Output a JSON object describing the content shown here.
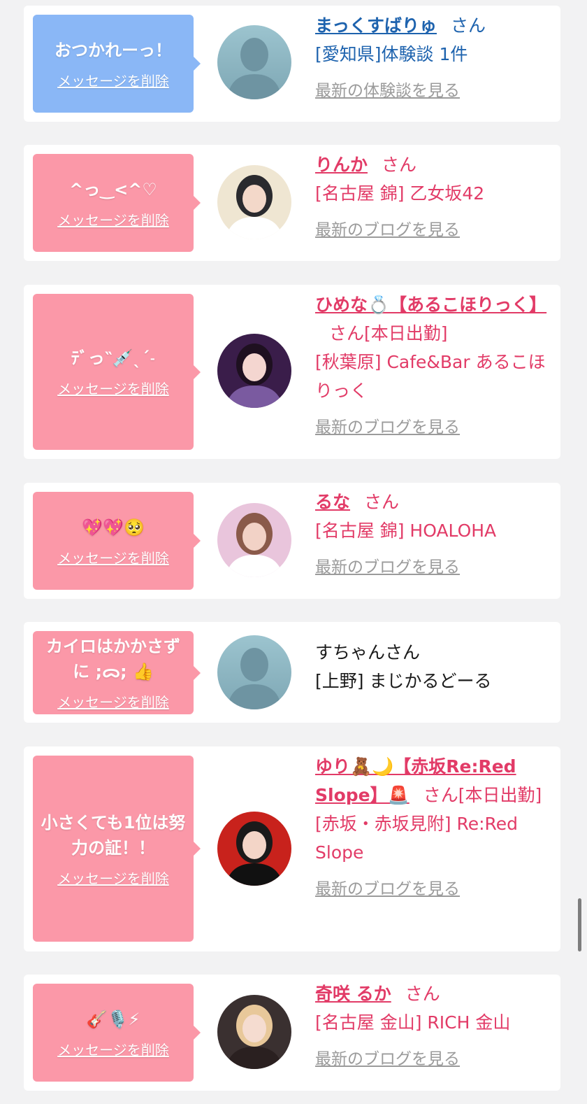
{
  "delete_label": "メッセージを削除",
  "colors": {
    "blue_bubble": "#8ab7f6",
    "pink_bubble": "#fb98a8",
    "blue_text": "#1e63ae",
    "pink_text": "#e23b67"
  },
  "cards": [
    {
      "message": "おつかれーっ！",
      "bubble": "blue",
      "name": "まっくすばりゅ",
      "suffix": "さん",
      "status": "",
      "detail": "[愛知県]体験談 1件",
      "link": "最新の体験談を見る",
      "avatar": "no-photo",
      "avatar_text": "no photo"
    },
    {
      "message": "^っ‿<^♡",
      "bubble": "pink",
      "name": "りんか",
      "suffix": "さん",
      "status": "",
      "detail": "[名古屋 錦] 乙女坂42",
      "link": "最新のブログを見る",
      "avatar": "photo-vip-bg"
    },
    {
      "message": "ﾃﾞっ‶💉ˎˊ˗",
      "bubble": "pink",
      "name": "ひめな💍【あるこほりっく】",
      "suffix": "さん",
      "status": "[本日出勤]",
      "detail": "[秋葉原] Cafe&Bar あるこほりっく",
      "link": "最新のブログを見る",
      "avatar": "photo-purple"
    },
    {
      "message": "💖💖🥺",
      "bubble": "pink",
      "name": "るな",
      "suffix": "さん",
      "status": "",
      "detail": "[名古屋 錦] HOALOHA",
      "link": "最新のブログを見る",
      "avatar": "photo-pink"
    },
    {
      "message": "カイロはかかさずに ;ᯅ; 👍",
      "bubble": "pink",
      "name": "",
      "suffix": "",
      "plain_name": "すちゃんさん",
      "status": "",
      "detail": "[上野] まじかるどーる",
      "link": "",
      "avatar": "no-photo",
      "avatar_text": "no photo"
    },
    {
      "message": "小さくても1位は努力の証！！",
      "bubble": "pink",
      "name": "ゆり🧸🌙【赤坂Re:Red Slope】🚨",
      "suffix": "さん",
      "status": "[本日出勤]",
      "detail": "[赤坂・赤坂見附] Re:Red Slope",
      "link": "最新のブログを見る",
      "avatar": "photo-red"
    },
    {
      "message": "🎸🎙️⚡",
      "bubble": "pink",
      "name": "奇咲 るか",
      "suffix": "さん",
      "status": "",
      "detail": "[名古屋 金山] RICH 金山",
      "link": "最新のブログを見る",
      "avatar": "photo-blonde"
    }
  ]
}
